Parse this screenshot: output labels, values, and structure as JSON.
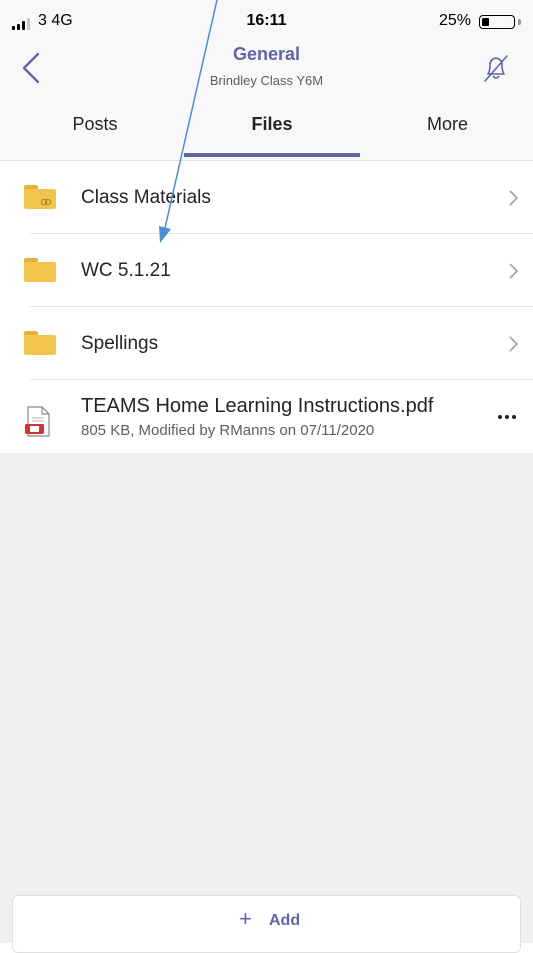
{
  "status_bar": {
    "carrier": "3  4G",
    "time": "16:11",
    "battery": "25%",
    "battery_level": 0.25
  },
  "header": {
    "title": "General",
    "subtitle": "Brindley Class Y6M",
    "back_icon": "chevron-left-icon",
    "notifications_icon": "bell-off-icon"
  },
  "tabs": [
    {
      "label": "Posts",
      "active": false
    },
    {
      "label": "Files",
      "active": true
    },
    {
      "label": "More",
      "active": false
    }
  ],
  "files": {
    "folders": [
      {
        "name": "Class Materials",
        "icon": "shared-folder-icon"
      },
      {
        "name": "WC 5.1.21",
        "icon": "folder-icon"
      },
      {
        "name": "Spellings",
        "icon": "folder-icon"
      }
    ],
    "documents": [
      {
        "name": "TEAMS Home Learning Instructions.pdf",
        "meta": "805 KB, Modified by RManns on 07/11/2020",
        "icon": "pdf-file-icon"
      }
    ]
  },
  "add": {
    "plus": "+",
    "label": "Add"
  },
  "colors": {
    "accent": "#6264a7",
    "folder": "#f2c44d",
    "annotation_arrow": "#4a8fd0"
  }
}
